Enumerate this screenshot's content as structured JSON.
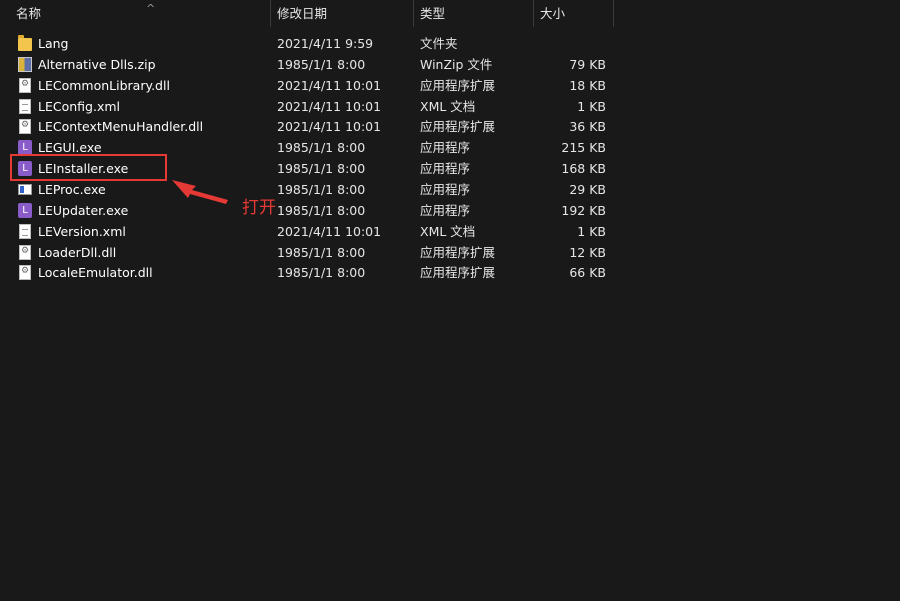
{
  "columns": {
    "name": "名称",
    "date": "修改日期",
    "type": "类型",
    "size": "大小"
  },
  "sort_indicator": "^",
  "files": [
    {
      "icon": "folder-icon",
      "kind": "folder",
      "name": "Lang",
      "date": "2021/4/11 9:59",
      "type": "文件夹",
      "size": ""
    },
    {
      "icon": "zip-icon",
      "kind": "zip",
      "name": "Alternative Dlls.zip",
      "date": "1985/1/1 8:00",
      "type": "WinZip 文件",
      "size": "79 KB"
    },
    {
      "icon": "dll-icon",
      "kind": "dll",
      "name": "LECommonLibrary.dll",
      "date": "2021/4/11 10:01",
      "type": "应用程序扩展",
      "size": "18 KB"
    },
    {
      "icon": "xml-icon",
      "kind": "xml",
      "name": "LEConfig.xml",
      "date": "2021/4/11 10:01",
      "type": "XML 文档",
      "size": "1 KB"
    },
    {
      "icon": "dll-icon",
      "kind": "dll",
      "name": "LEContextMenuHandler.dll",
      "date": "2021/4/11 10:01",
      "type": "应用程序扩展",
      "size": "36 KB"
    },
    {
      "icon": "le-app-icon",
      "kind": "le",
      "name": "LEGUI.exe",
      "date": "1985/1/1 8:00",
      "type": "应用程序",
      "size": "215 KB"
    },
    {
      "icon": "le-app-icon",
      "kind": "le",
      "name": "LEInstaller.exe",
      "date": "1985/1/1 8:00",
      "type": "应用程序",
      "size": "168 KB"
    },
    {
      "icon": "app-window-icon",
      "kind": "app",
      "name": "LEProc.exe",
      "date": "1985/1/1 8:00",
      "type": "应用程序",
      "size": "29 KB"
    },
    {
      "icon": "le-app-icon",
      "kind": "le",
      "name": "LEUpdater.exe",
      "date": "1985/1/1 8:00",
      "type": "应用程序",
      "size": "192 KB"
    },
    {
      "icon": "xml-icon",
      "kind": "xml",
      "name": "LEVersion.xml",
      "date": "2021/4/11 10:01",
      "type": "XML 文档",
      "size": "1 KB"
    },
    {
      "icon": "dll-icon",
      "kind": "dll",
      "name": "LoaderDll.dll",
      "date": "1985/1/1 8:00",
      "type": "应用程序扩展",
      "size": "12 KB"
    },
    {
      "icon": "dll-icon",
      "kind": "dll",
      "name": "LocaleEmulator.dll",
      "date": "1985/1/1 8:00",
      "type": "应用程序扩展",
      "size": "66 KB"
    }
  ],
  "le_icon_letter": "L",
  "annotation": {
    "label": "打开",
    "color": "#e53935",
    "target_file": "LEInstaller.exe"
  },
  "colors": {
    "background": "#191919",
    "text": "#ffffff",
    "le_icon": "#8a5cc9",
    "folder": "#f3c54d"
  }
}
